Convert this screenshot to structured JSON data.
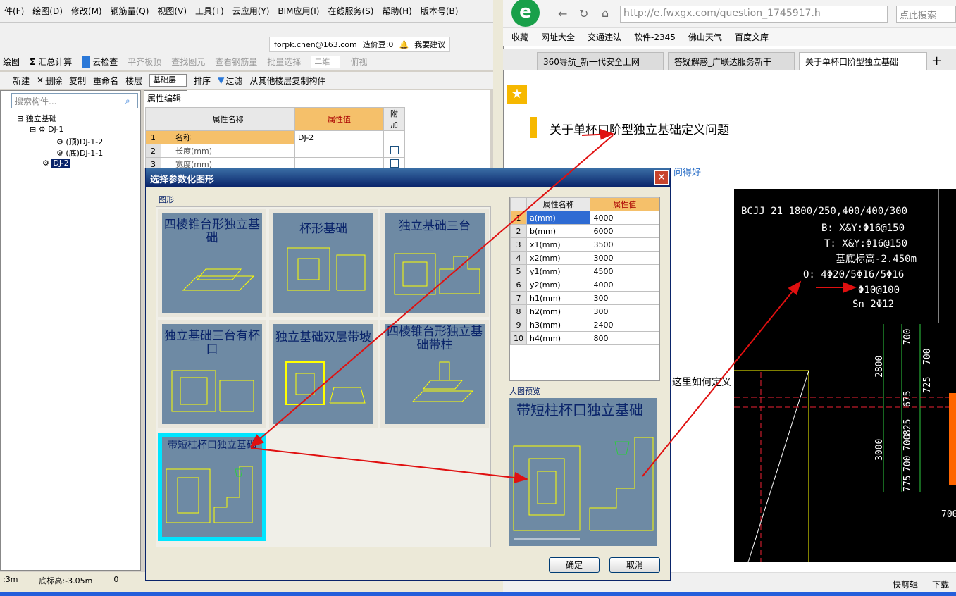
{
  "menu": [
    "件(F)",
    "绘图(D)",
    "修改(M)",
    "钢筋量(Q)",
    "视图(V)",
    "工具(T)",
    "云应用(Y)",
    "BIM应用(I)",
    "在线服务(S)",
    "帮助(H)",
    "版本号(B)"
  ],
  "user": {
    "email": "forpk.chen@163.com",
    "beans": "造价豆:0",
    "suggest": "我要建议"
  },
  "toolbar1": [
    "绘图",
    "汇总计算",
    "云检查",
    "平齐板顶",
    "查找图元",
    "查看钢筋量",
    "批量选择",
    "二维",
    "俯视"
  ],
  "toolbar2": [
    "新建",
    "删除",
    "复制",
    "重命名",
    "楼层",
    "基础层",
    "排序",
    "过滤",
    "从其他楼层复制构件"
  ],
  "search_placeholder": "搜索构件...",
  "tree": {
    "root": "独立基础",
    "dj1": "DJ-1",
    "top": "(顶)DJ-1-2",
    "bottom": "(底)DJ-1-1",
    "dj2": "DJ-2"
  },
  "prop": {
    "tab": "属性编辑",
    "headers": [
      "属性名称",
      "属性值",
      "附加"
    ],
    "rows": [
      {
        "n": "1",
        "name": "名称",
        "val": "DJ-2"
      },
      {
        "n": "2",
        "name": "长度(mm)",
        "val": ""
      },
      {
        "n": "3",
        "name": "宽度(mm)",
        "val": ""
      }
    ]
  },
  "status": {
    "a": ":3m",
    "b": "底标高:-3.05m",
    "c": "0"
  },
  "dialog": {
    "title": "选择参数化图形",
    "group_label": "图形",
    "shapes": [
      "四棱锥台形独立基础",
      "杯形基础",
      "独立基础三台",
      "独立基础三台有杯口",
      "独立基础双层带坡",
      "四棱锥台形独立基础带柱",
      "带短柱杯口独立基础"
    ],
    "params": {
      "headers": [
        "属性名称",
        "属性值"
      ],
      "rows": [
        {
          "n": "1",
          "name": "a(mm)",
          "val": "4000"
        },
        {
          "n": "2",
          "name": "b(mm)",
          "val": "6000"
        },
        {
          "n": "3",
          "name": "x1(mm)",
          "val": "3500"
        },
        {
          "n": "4",
          "name": "x2(mm)",
          "val": "3000"
        },
        {
          "n": "5",
          "name": "y1(mm)",
          "val": "4500"
        },
        {
          "n": "6",
          "name": "y2(mm)",
          "val": "4000"
        },
        {
          "n": "7",
          "name": "h1(mm)",
          "val": "300"
        },
        {
          "n": "8",
          "name": "h2(mm)",
          "val": "300"
        },
        {
          "n": "9",
          "name": "h3(mm)",
          "val": "2400"
        },
        {
          "n": "10",
          "name": "h4(mm)",
          "val": "800"
        }
      ]
    },
    "preview_label": "大图预览",
    "preview_title": "带短柱杯口独立基础",
    "ok": "确定",
    "cancel": "取消"
  },
  "browser": {
    "url": "http://e.fwxgx.com/question_1745917.h",
    "search": "点此搜索",
    "bookmarks": [
      "收藏",
      "网址大全",
      "交通违法",
      "软件-2345",
      "佛山天气",
      "百度文库"
    ],
    "tabs": [
      "360导航_新一代安全上网",
      "答疑解惑_广联达服务新干",
      "关于单杯口阶型独立基础"
    ],
    "question_title": "关于单杯口阶型独立基础定义问题",
    "link_fragment": "问得好",
    "body_fragment": "这里如何定义",
    "status": [
      "快剪辑",
      "下载"
    ]
  },
  "cad": {
    "lines": [
      "BCJJ 21 1800/250,400/400/300",
      "B: X&Y:Φ16@150",
      "T: X&Y:Φ16@150",
      "基底标高-2.450m",
      "O: 4Φ20/5Φ16/5Φ16",
      "Φ10@100",
      "Sn  2Φ12"
    ],
    "dims": [
      "700",
      "700",
      "2800",
      "725",
      "675",
      "825",
      "700",
      "3000",
      "700",
      "775",
      "700"
    ]
  }
}
